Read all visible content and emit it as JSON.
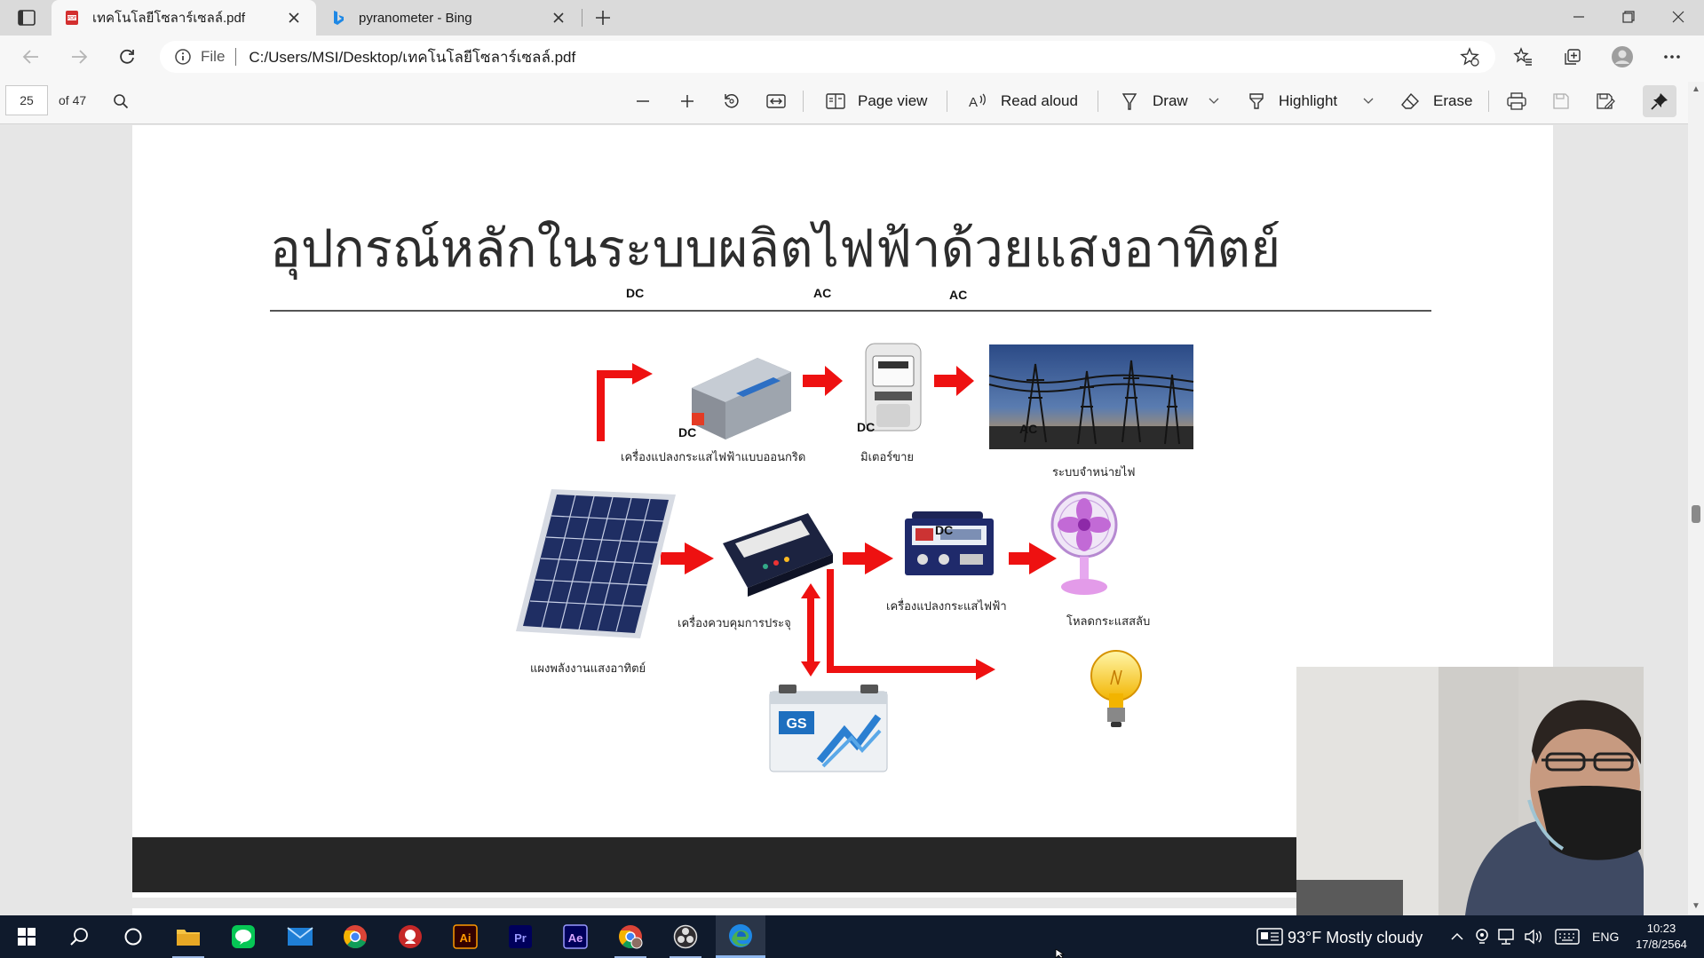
{
  "browser": {
    "tabs": [
      {
        "title": "เทคโนโลยีโซลาร์เซลล์.pdf",
        "active": true,
        "icon": "pdf-icon"
      },
      {
        "title": "pyranometer - Bing",
        "active": false,
        "icon": "bing-icon"
      }
    ],
    "address": {
      "scheme": "File",
      "url": "C:/Users/MSI/Desktop/เทคโนโลยีโซลาร์เซลล์.pdf"
    }
  },
  "pdf_toolbar": {
    "page_current": "25",
    "page_total": "of 47",
    "page_view": "Page view",
    "read_aloud": "Read aloud",
    "draw": "Draw",
    "highlight": "Highlight",
    "erase": "Erase"
  },
  "slide": {
    "title": "อุปกรณ์หลักในระบบผลิตไฟฟ้าด้วยแสงอาทิตย์",
    "labels": {
      "grid_inverter": "เครื่องแปลงกระแสไฟฟ้าแบบออนกริด",
      "meter": "มิเตอร์ขาย",
      "grid": "ระบบจำหน่ายไฟ",
      "panel": "แผงพลังงานแสงอาทิตย์",
      "charge_controller": "เครื่องควบคุมการประจุ",
      "inverter": "เครื่องแปลงกระแสไฟฟ้า",
      "ac_load": "โหลดกระแสสลับ"
    },
    "current": {
      "dc": "DC",
      "ac": "AC"
    },
    "battery_brand": "GS"
  },
  "taskbar": {
    "weather": "93°F  Mostly cloudy",
    "language": "ENG",
    "time": "10:23",
    "date": "17/8/2564",
    "apps": [
      "start-icon",
      "search-icon",
      "task-view-icon",
      "file-explorer-icon",
      "line-icon",
      "mail-icon",
      "chrome-icon",
      "app-red-icon",
      "illustrator-icon",
      "premiere-icon",
      "after-effects-icon",
      "chrome-profile-icon",
      "obs-icon",
      "edge-icon"
    ]
  },
  "colors": {
    "arrow_red": "#ee1111",
    "taskbar_bg": "#0f1a2c",
    "footer_band": "#262626"
  }
}
